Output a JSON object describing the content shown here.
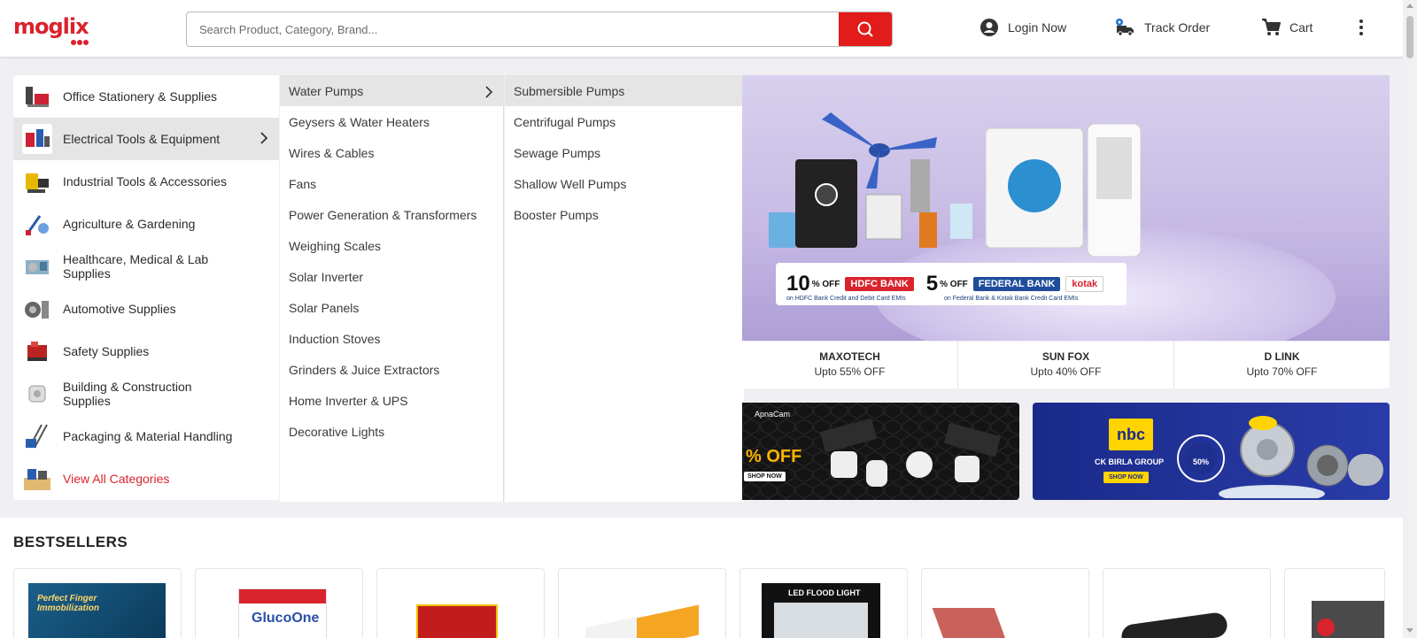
{
  "header": {
    "logo_text": "moglix",
    "search_placeholder": "Search Product, Category, Brand...",
    "login_label": "Login Now",
    "track_label": "Track Order",
    "cart_label": "Cart"
  },
  "categories": [
    {
      "label": "Office Stationery & Supplies",
      "icon": "office-icon"
    },
    {
      "label": "Electrical Tools & Equipment",
      "icon": "electrical-icon",
      "active": true
    },
    {
      "label": "Industrial Tools & Accessories",
      "icon": "industrial-icon"
    },
    {
      "label": "Agriculture & Gardening",
      "icon": "agriculture-icon"
    },
    {
      "label": "Healthcare, Medical & Lab Supplies",
      "icon": "healthcare-icon"
    },
    {
      "label": "Automotive Supplies",
      "icon": "automotive-icon"
    },
    {
      "label": "Safety Supplies",
      "icon": "safety-icon"
    },
    {
      "label": "Building & Construction Supplies",
      "icon": "building-icon"
    },
    {
      "label": "Packaging & Material Handling",
      "icon": "packaging-icon"
    },
    {
      "label": "View All Categories",
      "icon": "view-all-icon"
    }
  ],
  "subcategories": [
    "Water Pumps",
    "Geysers & Water Heaters",
    "Wires & Cables",
    "Fans",
    "Power Generation & Transformers",
    "Weighing Scales",
    "Solar Inverter",
    "Solar Panels",
    "Induction Stoves",
    "Grinders & Juice Extractors",
    "Home Inverter & UPS",
    "Decorative Lights"
  ],
  "subsubcategories": [
    "Submersible Pumps",
    "Centrifugal Pumps",
    "Sewage Pumps",
    "Shallow Well Pumps",
    "Booster Pumps"
  ],
  "banner": {
    "offer1_pct": "10",
    "offer1_off": "% OFF",
    "offer1_bank": "HDFC BANK",
    "offer1_sub": "on HDFC Bank Credit and Debit Card EMIs",
    "offer2_pct": "5",
    "offer2_off": "% OFF",
    "offer2_bank": "FEDERAL BANK",
    "offer2_bank2": "kotak",
    "offer2_sub": "on Federal Bank & Kotak Bank Credit Card EMIs"
  },
  "brands": [
    {
      "name": "MAXOTECH",
      "offer": "Upto 55% OFF"
    },
    {
      "name": "SUN FOX",
      "offer": "Upto 40% OFF"
    },
    {
      "name": "D LINK",
      "offer": "Upto 70% OFF"
    }
  ],
  "promo1": {
    "brand": "ApnaCam",
    "offer": "% OFF",
    "cta": "SHOP NOW"
  },
  "promo2": {
    "brand": "nbc",
    "group": "CK BIRLA GROUP",
    "cta": "SHOP NOW",
    "badge": "50%"
  },
  "bestsellers": {
    "title": "BESTSELLERS",
    "card1_text": "Perfect Finger Immobilization",
    "card2_text": "GlucoOne",
    "card4_text": "LED FLOOD LIGHT"
  }
}
